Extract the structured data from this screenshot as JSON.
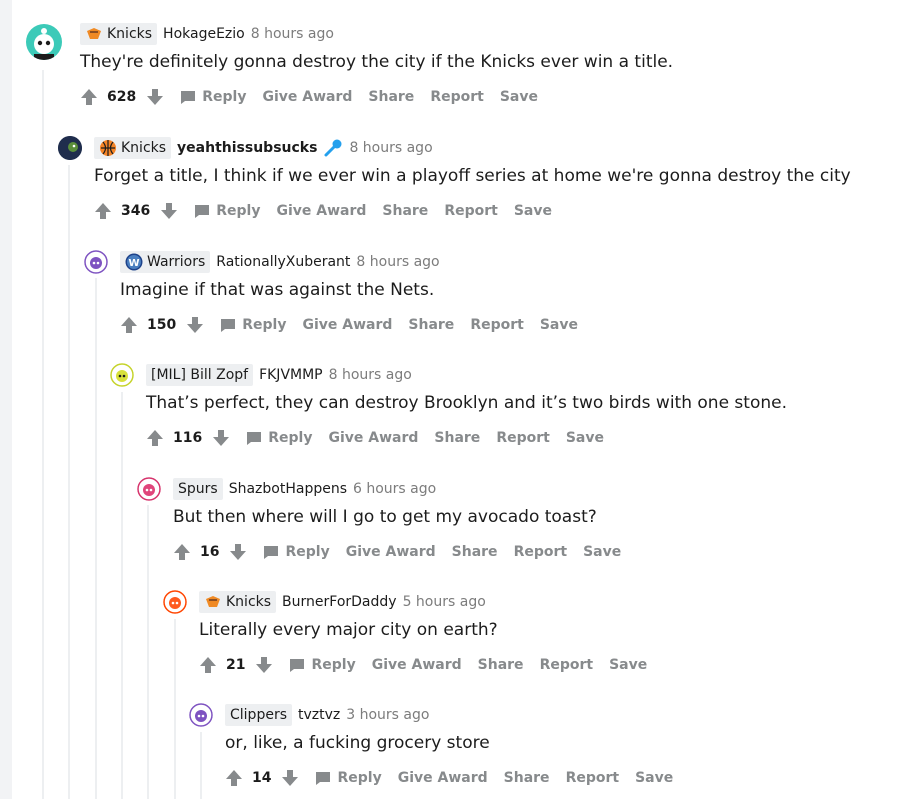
{
  "comments": [
    {
      "flair": "Knicks",
      "author": "HokageEzio",
      "time": "8 hours ago",
      "body": "They're definitely gonna destroy the city if the Knicks ever win a title.",
      "score": "628"
    },
    {
      "flair": "Knicks",
      "author": "yeahthissubsucks",
      "time": "8 hours ago",
      "body": "Forget a title, I think if we ever win a playoff series at home we're gonna destroy the city",
      "score": "346"
    },
    {
      "flair": "Warriors",
      "author": "RationallyXuberant",
      "time": "8 hours ago",
      "body": "Imagine if that was against the Nets.",
      "score": "150"
    },
    {
      "flair": "[MIL] Bill Zopf",
      "author": "FKJVMMP",
      "time": "8 hours ago",
      "body": "That’s perfect, they can destroy Brooklyn and it’s two birds with one stone.",
      "score": "116"
    },
    {
      "flair": "Spurs",
      "author": "ShazbotHappens",
      "time": "6 hours ago",
      "body": "But then where will I go to get my avocado toast?",
      "score": "16"
    },
    {
      "flair": "Knicks",
      "author": "BurnerForDaddy",
      "time": "5 hours ago",
      "body": "Literally every major city on earth?",
      "score": "21"
    },
    {
      "flair": "Clippers",
      "author": "tvztvz",
      "time": "3 hours ago",
      "body": "or, like, a fucking grocery store",
      "score": "14"
    }
  ],
  "actions": {
    "reply": "Reply",
    "give_award": "Give Award",
    "share": "Share",
    "report": "Report",
    "save": "Save"
  },
  "colors": {
    "upvote": "#878a8c",
    "meta": "#7c7c7c",
    "flair_bg": "#edeff1",
    "mic": "#24a0ed",
    "thread_line": "#edeff1"
  }
}
